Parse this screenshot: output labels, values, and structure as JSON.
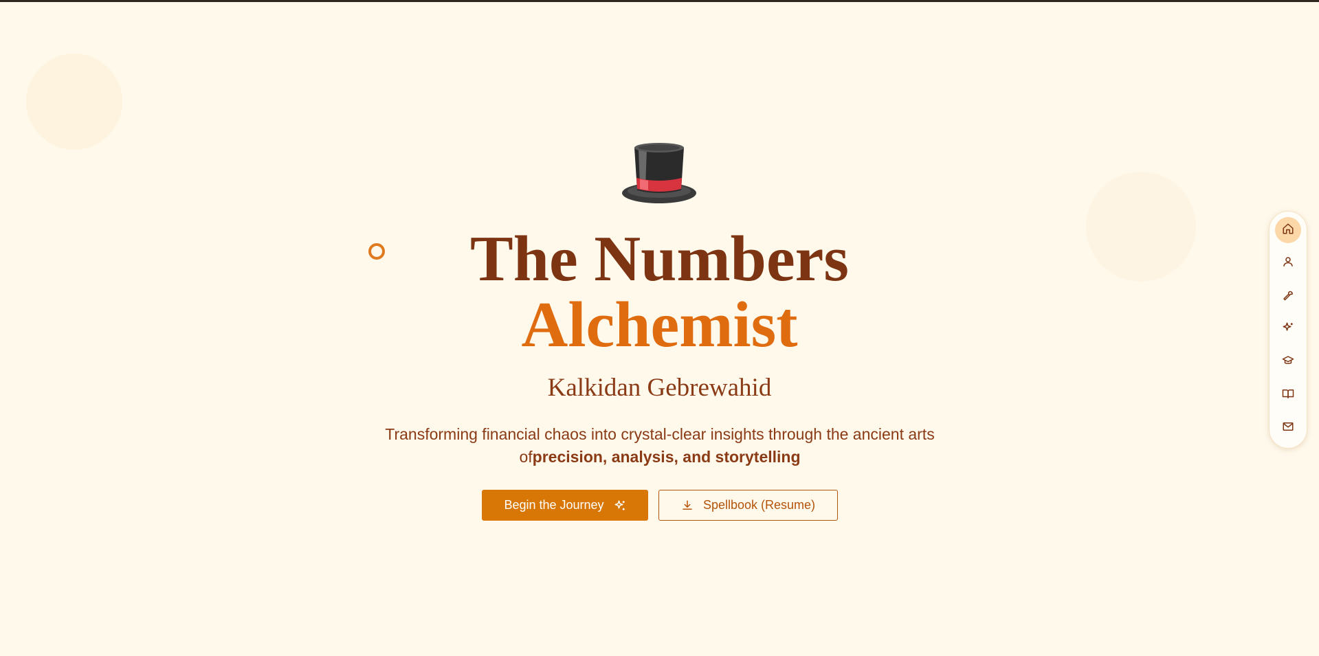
{
  "hero": {
    "title_line1": "The Numbers",
    "title_line2": "Alchemist",
    "name": "Kalkidan Gebrewahid",
    "tagline_prefix": "Transforming financial chaos into crystal-clear insights through the ancient arts of",
    "tagline_emphasis": "precision, analysis, and storytelling"
  },
  "buttons": {
    "primary_label": "Begin the Journey",
    "secondary_label": "Spellbook (Resume)"
  },
  "side_nav": {
    "items": [
      {
        "icon": "home-icon",
        "active": true
      },
      {
        "icon": "user-icon",
        "active": false
      },
      {
        "icon": "wrench-icon",
        "active": false
      },
      {
        "icon": "sparkles-icon",
        "active": false
      },
      {
        "icon": "graduation-cap-icon",
        "active": false
      },
      {
        "icon": "book-open-icon",
        "active": false
      },
      {
        "icon": "mail-icon",
        "active": false
      }
    ]
  },
  "colors": {
    "background": "#fff9ec",
    "title_dark": "#7c3412",
    "title_accent": "#e06c10",
    "button_primary": "#d97706",
    "nav_active": "#fcd7a8"
  }
}
